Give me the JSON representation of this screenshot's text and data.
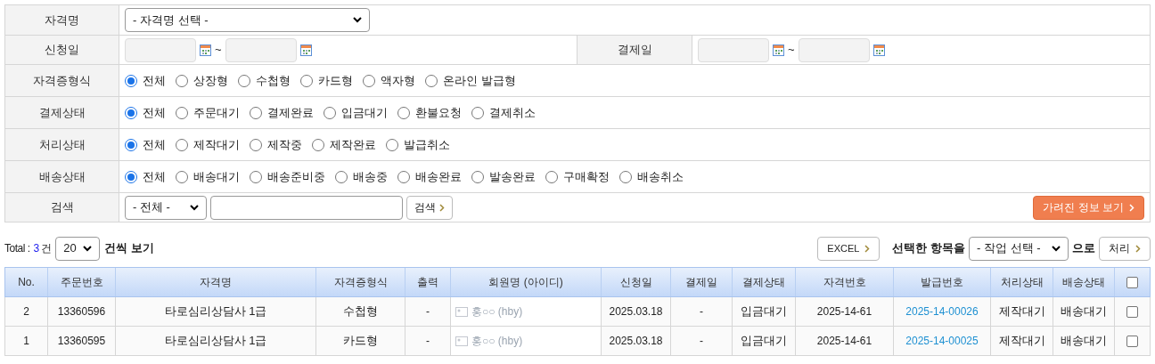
{
  "filters": [
    {
      "kind": "select",
      "label": "자격명",
      "value": "- 자격명 선택 -"
    },
    {
      "kind": "dates",
      "label": "신청일",
      "tilde": "~",
      "label2": "결제일",
      "tilde2": "~"
    },
    {
      "kind": "radios",
      "label": "자격증형식",
      "options": [
        {
          "label": "전체",
          "selected": true
        },
        {
          "label": "상장형",
          "selected": false
        },
        {
          "label": "수첩형",
          "selected": false
        },
        {
          "label": "카드형",
          "selected": false
        },
        {
          "label": "액자형",
          "selected": false
        },
        {
          "label": "온라인 발급형",
          "selected": false
        }
      ]
    },
    {
      "kind": "radios",
      "label": "결제상태",
      "options": [
        {
          "label": "전체",
          "selected": true
        },
        {
          "label": "주문대기",
          "selected": false
        },
        {
          "label": "결제완료",
          "selected": false
        },
        {
          "label": "입금대기",
          "selected": false
        },
        {
          "label": "환불요청",
          "selected": false
        },
        {
          "label": "결제취소",
          "selected": false
        }
      ]
    },
    {
      "kind": "radios",
      "label": "처리상태",
      "options": [
        {
          "label": "전체",
          "selected": true
        },
        {
          "label": "제작대기",
          "selected": false
        },
        {
          "label": "제작중",
          "selected": false
        },
        {
          "label": "제작완료",
          "selected": false
        },
        {
          "label": "발급취소",
          "selected": false
        }
      ]
    },
    {
      "kind": "radios",
      "label": "배송상태",
      "options": [
        {
          "label": "전체",
          "selected": true
        },
        {
          "label": "배송대기",
          "selected": false
        },
        {
          "label": "배송준비중",
          "selected": false
        },
        {
          "label": "배송중",
          "selected": false
        },
        {
          "label": "배송완료",
          "selected": false
        },
        {
          "label": "발송완료",
          "selected": false
        },
        {
          "label": "구매확정",
          "selected": false
        },
        {
          "label": "배송취소",
          "selected": false
        }
      ]
    },
    {
      "kind": "search",
      "label": "검색",
      "select": "- 전체 -",
      "button": "검색",
      "extra_button": "가려진 정보 보기"
    }
  ],
  "toolbar": {
    "total_label": "Total :",
    "total": "3",
    "unit": "건",
    "page_size": "20",
    "page_size_suffix": "건씩 보기",
    "excel": "EXCEL",
    "bulk_label": "선택한 항목을",
    "bulk_select": "- 작업 선택 -",
    "bulk_suffix": "으로",
    "bulk_button": "처리"
  },
  "table": {
    "columns": [
      "No.",
      "주문번호",
      "자격명",
      "자격증형식",
      "출력",
      "회원명 (아이디)",
      "신청일",
      "결제일",
      "결제상태",
      "자격번호",
      "발급번호",
      "처리상태",
      "배송상태"
    ],
    "header_checked": false,
    "rows": [
      {
        "no": "2",
        "order": "13360596",
        "name": "타로심리상담사 1급",
        "format": "수첩형",
        "print": "-",
        "member": "홍○○ (hby)",
        "applied": "2025.03.18",
        "paid": "-",
        "pay_status": "입금대기",
        "cert_no": "2025-14-61",
        "issue_no": "2025-14-00026",
        "proc_status": "제작대기",
        "ship_status": "배송대기",
        "checked": false
      },
      {
        "no": "1",
        "order": "13360595",
        "name": "타로심리상담사 1급",
        "format": "카드형",
        "print": "-",
        "member": "홍○○ (hby)",
        "applied": "2025.03.18",
        "paid": "-",
        "pay_status": "입금대기",
        "cert_no": "2025-14-61",
        "issue_no": "2025-14-00025",
        "proc_status": "제작대기",
        "ship_status": "배송대기",
        "checked": false
      }
    ]
  }
}
